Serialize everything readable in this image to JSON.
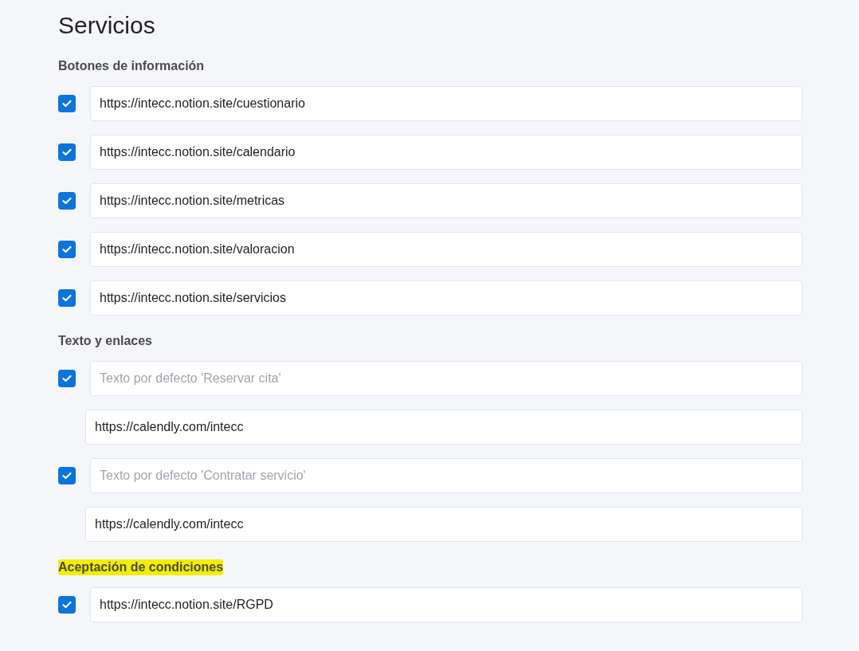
{
  "page": {
    "title": "Servicios"
  },
  "sections": [
    {
      "heading": "Botones de información",
      "highlighted": false,
      "items": [
        {
          "kind": "checkbox_field",
          "checked": true,
          "value": "https://intecc.notion.site/cuestionario"
        },
        {
          "kind": "checkbox_field",
          "checked": true,
          "value": "https://intecc.notion.site/calendario"
        },
        {
          "kind": "checkbox_field",
          "checked": true,
          "value": "https://intecc.notion.site/metricas"
        },
        {
          "kind": "checkbox_field",
          "checked": true,
          "value": "https://intecc.notion.site/valoracion"
        },
        {
          "kind": "checkbox_field",
          "checked": true,
          "value": "https://intecc.notion.site/servicios"
        }
      ]
    },
    {
      "heading": "Texto y enlaces",
      "highlighted": false,
      "items": [
        {
          "kind": "checkbox_field",
          "checked": true,
          "placeholder": "Texto por defecto 'Reservar cita'"
        },
        {
          "kind": "field",
          "value": "https://calendly.com/intecc"
        },
        {
          "kind": "checkbox_field",
          "checked": true,
          "placeholder": "Texto por defecto 'Contratar servicio'"
        },
        {
          "kind": "field",
          "value": "https://calendly.com/intecc"
        }
      ]
    },
    {
      "heading": "Aceptación de condiciones",
      "highlighted": true,
      "items": [
        {
          "kind": "checkbox_field",
          "checked": true,
          "value": "https://intecc.notion.site/RGPD"
        }
      ]
    }
  ]
}
